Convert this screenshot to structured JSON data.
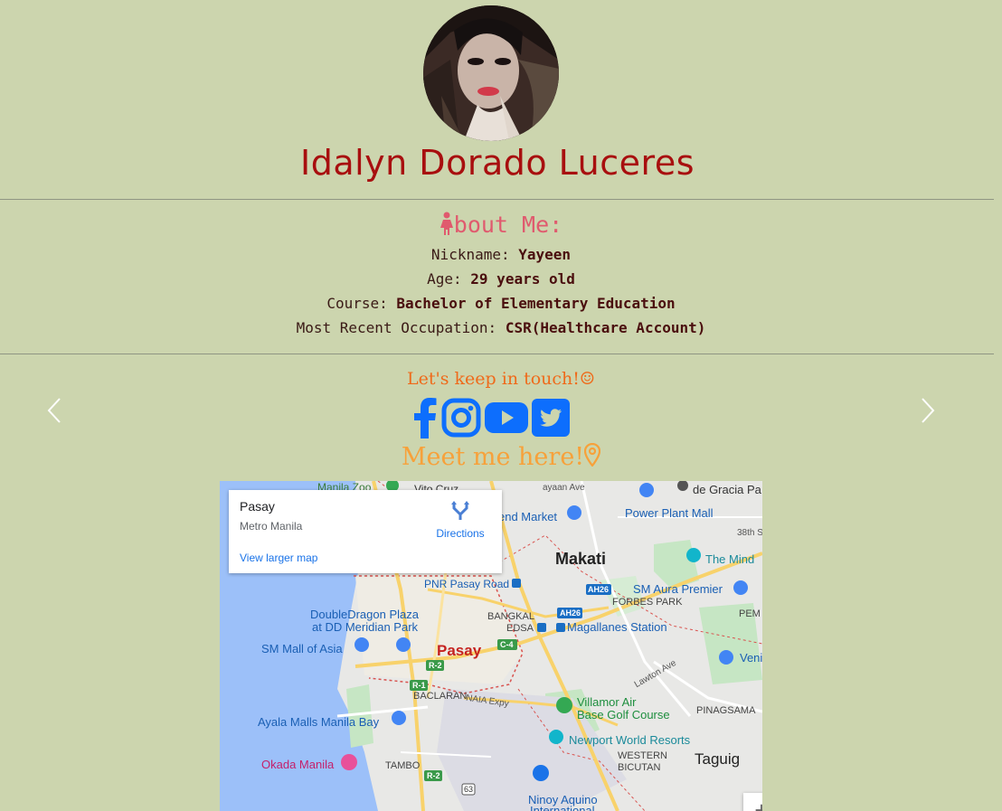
{
  "profile": {
    "name": "Idalyn Dorado Luceres"
  },
  "about": {
    "title": "bout Me:",
    "rows": [
      {
        "label": "Nickname:",
        "value": "Yayeen"
      },
      {
        "label": "Age:",
        "value": "29 years old"
      },
      {
        "label": "Course:",
        "value": "Bachelor of Elementary Education"
      },
      {
        "label": "Most Recent Occupation:",
        "value": "CSR(Healthcare Account)"
      }
    ]
  },
  "contact": {
    "touch_text": "Let's keep in touch!",
    "touch_emoji": "☺",
    "meet_text": "Meet me here!",
    "socials": [
      "facebook-icon",
      "instagram-icon",
      "youtube-icon",
      "twitter-icon"
    ],
    "social_color": "#0d6efd"
  },
  "map": {
    "place_title": "Pasay",
    "place_subtitle": "Metro Manila",
    "directions_label": "Directions",
    "larger_map_label": "View larger map",
    "zoom_in_label": "+",
    "labels": {
      "manila_zoo": "Manila Zoo",
      "vito_cruz": "Vito Cruz",
      "ayaan_ave": "ayaan Ave",
      "de_gracia": "de Gracia Pa",
      "end_market": "end Market",
      "power_plant": "Power Plant Mall",
      "st38": "38th S",
      "makati": "Makati",
      "the_mind": "The Mind",
      "pnr": "PNR Pasay Road",
      "ah26a": "AH26",
      "forbes": "FORBES PARK",
      "sm_aura": "SM Aura Premier",
      "pem": "PEM",
      "doubledragon1": "DoubleDragon Plaza",
      "doubledragon2": "at DD Meridian Park",
      "bangkal": "BANGKAL",
      "ah26b": "AH26",
      "edsa": "EDSA",
      "magallanes": "Magallanes Station",
      "sm_asia": "SM Mall of Asia",
      "pasay": "Pasay",
      "c4": "C-4",
      "r2a": "R-2",
      "veni": "Veni",
      "lawton": "Lawton Ave",
      "r1": "R-1",
      "baclaran": "BACLARAN",
      "naia": "NAIA Expy",
      "villamor1": "Villamor Air",
      "villamor2": "Base Golf Course",
      "pinagsama": "PINAGSAMA",
      "ayala": "Ayala Malls Manila Bay",
      "newport": "Newport World Resorts",
      "western1": "WESTERN",
      "western2": "BICUTAN",
      "taguig": "Taguig",
      "okada": "Okada Manila",
      "tambo": "TAMBO",
      "r2b": "R-2",
      "n63": "63",
      "ninoy1": "Ninoy Aquino",
      "ninoy2": "International"
    }
  }
}
